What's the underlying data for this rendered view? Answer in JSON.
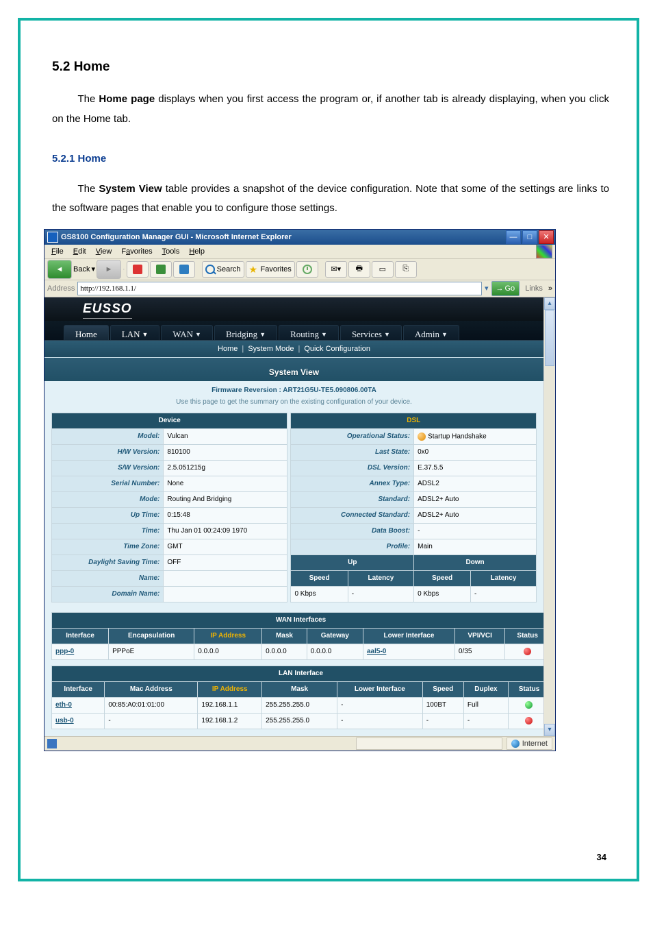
{
  "doc": {
    "heading": "5.2  Home",
    "para1_pre": "The ",
    "para1_bold": "Home page",
    "para1_post": " displays when you first access the program or, if another tab is already displaying, when you click on the Home tab.",
    "subheading": "5.2.1    Home",
    "para2_pre": "The ",
    "para2_bold": "System View",
    "para2_post": " table provides a snapshot of the device configuration. Note that some of the settings are links to the software pages that enable you to configure those settings.",
    "page_number": "34"
  },
  "ie": {
    "title": "GS8100 Configuration Manager GUI - Microsoft Internet Explorer",
    "menu": {
      "file": "File",
      "edit": "Edit",
      "view": "View",
      "favorites": "Favorites",
      "tools": "Tools",
      "help": "Help"
    },
    "toolbar": {
      "back": "Back",
      "search": "Search",
      "favorites": "Favorites"
    },
    "addressbar": {
      "label": "Address",
      "value": "http://192.168.1.1/",
      "go": "Go",
      "links": "Links",
      "chev": "»"
    },
    "statusbar": {
      "zone": "Internet"
    }
  },
  "router": {
    "brand": "EUSSO",
    "tabs": [
      "Home",
      "LAN",
      "WAN",
      "Bridging",
      "Routing",
      "Services",
      "Admin"
    ],
    "subnav": {
      "home": "Home",
      "mode": "System Mode",
      "quick": "Quick Configuration"
    },
    "system_view": {
      "title": "System View",
      "firmware_label": "Firmware Reversion : ",
      "firmware": "ART21G5U-TE5.090806.00TA",
      "note": "Use this page to get the summary on the existing configuration of your device."
    },
    "device": {
      "section": "Device",
      "model_label": "Model:",
      "model": "Vulcan",
      "hw_label": "H/W Version:",
      "hw": "810100",
      "sw_label": "S/W Version:",
      "sw": "2.5.051215g",
      "serial_label": "Serial Number:",
      "serial": "None",
      "mode_label": "Mode:",
      "mode": "Routing And Bridging",
      "uptime_label": "Up Time:",
      "uptime": "0:15:48",
      "time_label": "Time:",
      "time": "Thu Jan 01 00:24:09 1970",
      "tz_label": "Time Zone:",
      "tz": "GMT",
      "dst_label": "Daylight Saving Time:",
      "dst": "OFF",
      "name_label": "Name:",
      "name": "",
      "domain_label": "Domain Name:",
      "domain": ""
    },
    "dsl": {
      "section": "DSL",
      "op_label": "Operational Status:",
      "op": "Startup Handshake",
      "last_label": "Last State:",
      "last": "0x0",
      "ver_label": "DSL Version:",
      "ver": "E.37.5.5",
      "annex_label": "Annex Type:",
      "annex": "ADSL2",
      "std_label": "Standard:",
      "std": "ADSL2+ Auto",
      "conn_label": "Connected Standard:",
      "conn": "ADSL2+ Auto",
      "boost_label": "Data Boost:",
      "boost": "-",
      "profile_label": "Profile:",
      "profile": "Main"
    },
    "dsl_stats": {
      "up": "Up",
      "down": "Down",
      "speed": "Speed",
      "latency": "Latency",
      "up_speed": "0 Kbps",
      "up_latency": "-",
      "down_speed": "0 Kbps",
      "down_latency": "-"
    },
    "wan": {
      "title": "WAN Interfaces",
      "cols": {
        "iface": "Interface",
        "encap": "Encapsulation",
        "ip": "IP Address",
        "mask": "Mask",
        "gw": "Gateway",
        "li": "Lower Interface",
        "vpi": "VPI/VCI",
        "status": "Status"
      },
      "row": {
        "iface": "ppp-0",
        "encap": "PPPoE",
        "ip": "0.0.0.0",
        "mask": "0.0.0.0",
        "gw": "0.0.0.0",
        "li": "aal5-0",
        "vpi": "0/35"
      }
    },
    "lan": {
      "title": "LAN Interface",
      "cols": {
        "iface": "Interface",
        "mac": "Mac Address",
        "ip": "IP Address",
        "mask": "Mask",
        "li": "Lower Interface",
        "speed": "Speed",
        "duplex": "Duplex",
        "status": "Status"
      },
      "rows": [
        {
          "iface": "eth-0",
          "mac": "00:85:A0:01:01:00",
          "ip": "192.168.1.1",
          "mask": "255.255.255.0",
          "li": "-",
          "speed": "100BT",
          "duplex": "Full",
          "status": "green"
        },
        {
          "iface": "usb-0",
          "mac": "-",
          "ip": "192.168.1.2",
          "mask": "255.255.255.0",
          "li": "-",
          "speed": "-",
          "duplex": "-",
          "status": "red"
        }
      ]
    }
  }
}
